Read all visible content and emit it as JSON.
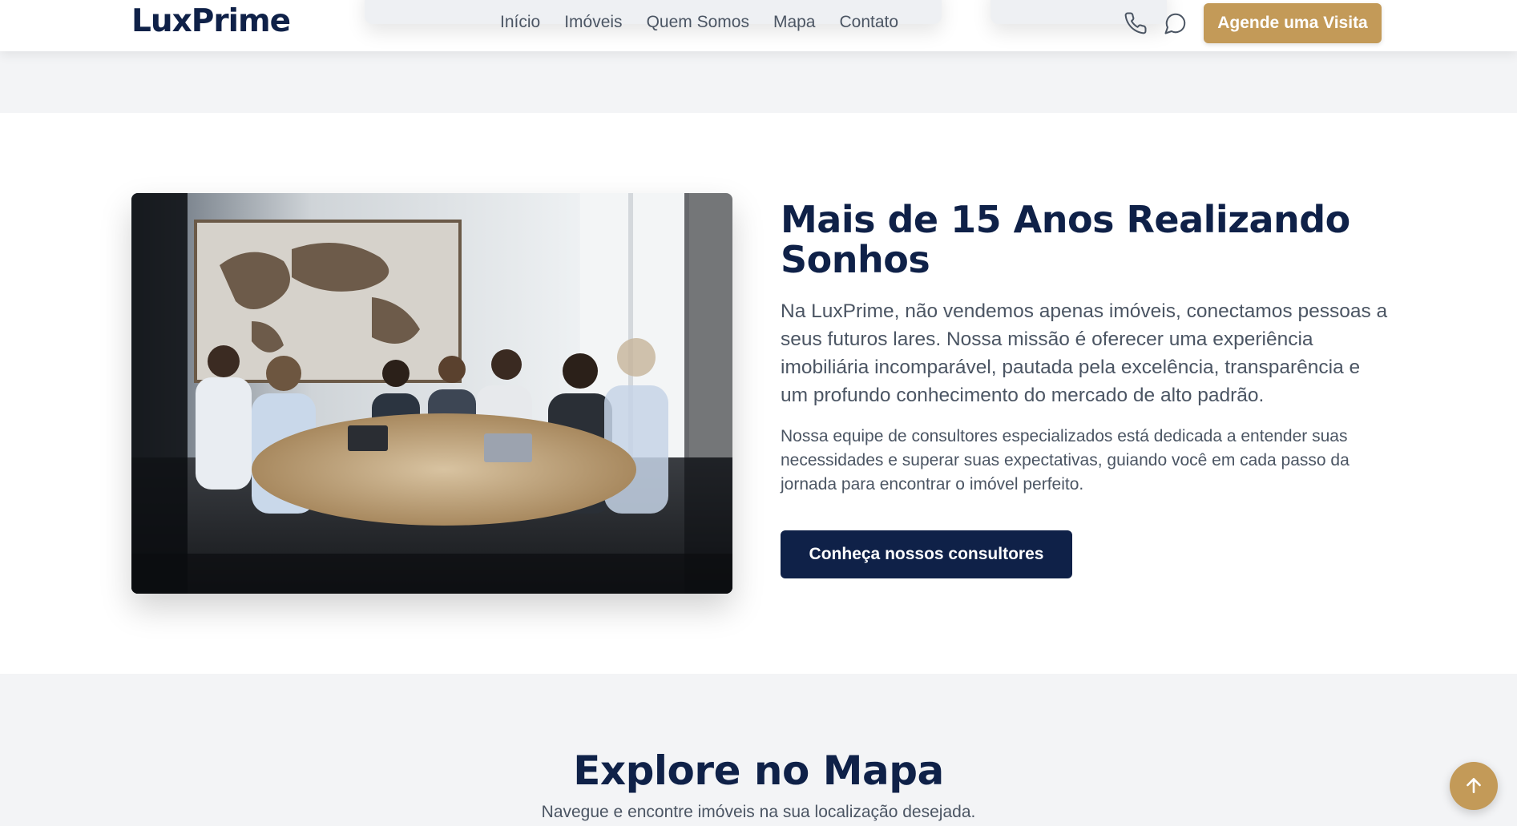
{
  "brand": {
    "logo": "LuxPrime"
  },
  "nav": {
    "items": [
      "Início",
      "Imóveis",
      "Quem Somos",
      "Mapa",
      "Contato"
    ]
  },
  "header": {
    "icons": [
      "phone-icon",
      "chat-bubble-icon"
    ],
    "cta_label": "Agende uma Visita"
  },
  "about": {
    "image_alt": "Equipe de consultores reunida em torno de uma mesa redonda",
    "title": "Mais de 15 Anos Realizando Sonhos",
    "lead": "Na LuxPrime, não vendemos apenas imóveis, conectamos pessoas a seus futuros lares. Nossa missão é oferecer uma experiência imobiliária incomparável, pautada pela excelência, transparência e um profundo conhecimento do mercado de alto padrão.",
    "body": "Nossa equipe de consultores especializados está dedicada a entender suas necessidades e superar suas expectativas, guiando você em cada passo da jornada para encontrar o imóvel perfeito.",
    "cta_label": "Conheça nossos consultores"
  },
  "map_section": {
    "title": "Explore no Mapa",
    "subtitle": "Navegue e encontre imóveis na sua localização desejada."
  },
  "back_to_top": {
    "icon": "arrow-up-icon"
  },
  "colors": {
    "navy": "#0f2148",
    "gold": "#c39a58",
    "text_muted": "#4b5563",
    "section_gray": "#f3f4f6",
    "white": "#ffffff"
  }
}
